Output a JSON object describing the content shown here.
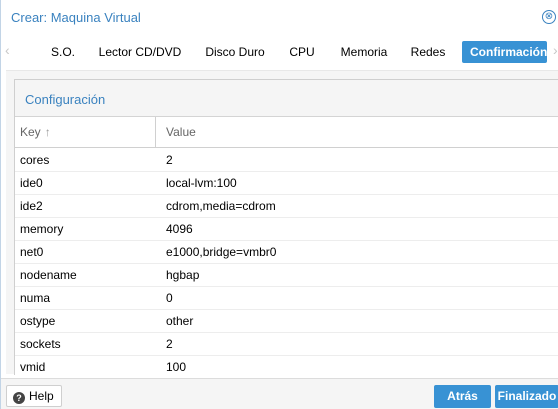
{
  "window": {
    "title": "Crear: Maquina Virtual",
    "close_icon": "⊗"
  },
  "tabs": [
    {
      "label": "S.O."
    },
    {
      "label": "Lector CD/DVD"
    },
    {
      "label": "Disco Duro"
    },
    {
      "label": "CPU"
    },
    {
      "label": "Memoria"
    },
    {
      "label": "Redes"
    },
    {
      "label": "Confirmación",
      "active": true
    }
  ],
  "panel": {
    "title": "Configuración",
    "columns": {
      "key": "Key",
      "value": "Value"
    },
    "sort_icon": "↑",
    "rows": [
      {
        "key": "cores",
        "value": "2"
      },
      {
        "key": "ide0",
        "value": "local-lvm:100"
      },
      {
        "key": "ide2",
        "value": "cdrom,media=cdrom"
      },
      {
        "key": "memory",
        "value": "4096"
      },
      {
        "key": "net0",
        "value": "e1000,bridge=vmbr0"
      },
      {
        "key": "nodename",
        "value": "hgbap"
      },
      {
        "key": "numa",
        "value": "0"
      },
      {
        "key": "ostype",
        "value": "other"
      },
      {
        "key": "sockets",
        "value": "2"
      },
      {
        "key": "vmid",
        "value": "100"
      }
    ]
  },
  "footer": {
    "help_label": "Help",
    "help_icon": "?",
    "back_label": "Atrás",
    "finish_label": "Finalizado"
  },
  "colors": {
    "accent": "#3892d4",
    "title": "#3a82bf"
  }
}
